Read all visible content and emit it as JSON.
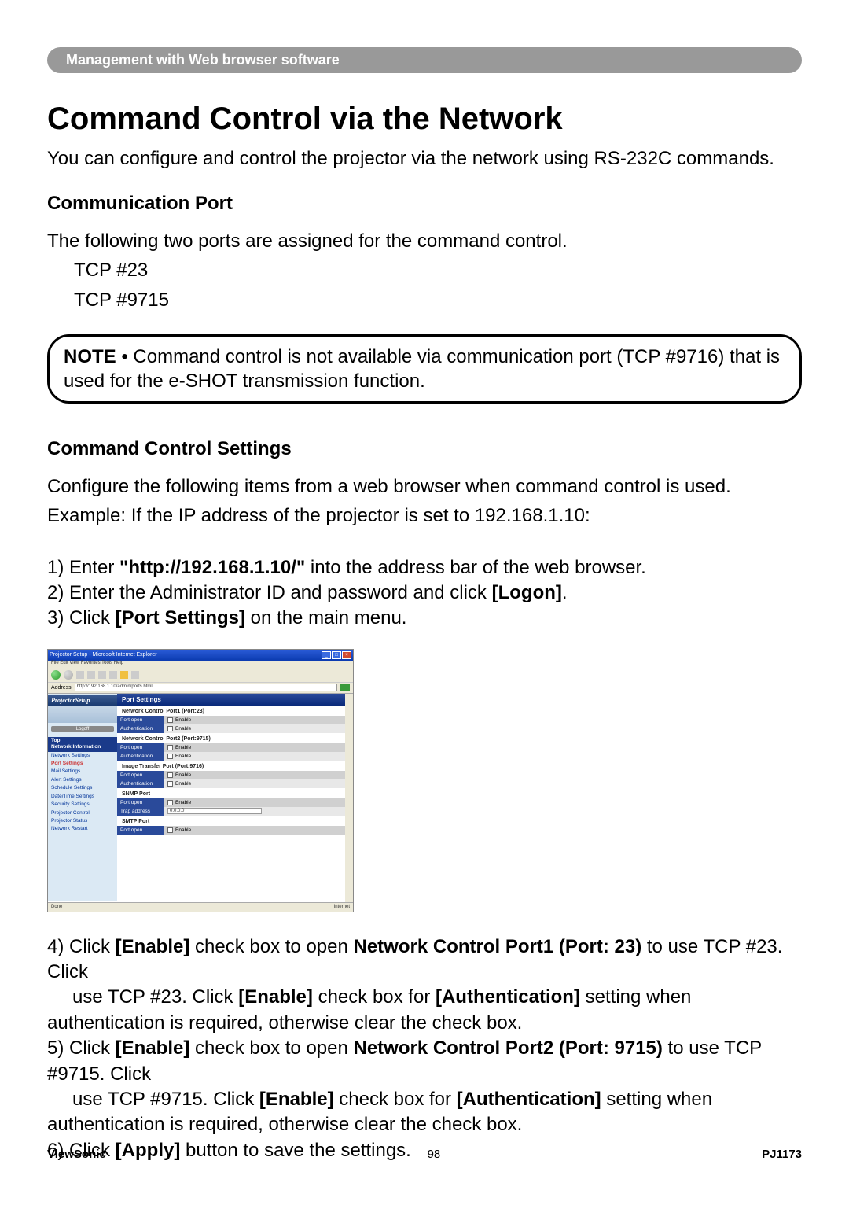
{
  "header_bar": "Management with Web browser software",
  "title": "Command Control via the Network",
  "intro": "You can configure and control the projector via the network using RS-232C commands.",
  "comm_port_heading": "Communication Port",
  "comm_port_text": "The following two ports are assigned for the command control.",
  "comm_port_1": "TCP #23",
  "comm_port_2": "TCP #9715",
  "note_label": "NOTE",
  "note_text": " • Command control is not available via communication port (TCP #9716) that is used for the e-SHOT transmission function.",
  "settings_heading": "Command Control Settings",
  "settings_text1": "Configure the following items from a web browser when command control is used.",
  "settings_text2": "Example: If the IP address of the projector is set to 192.168.1.10:",
  "step1_pre": "1) Enter ",
  "step1_bold": "\"http://192.168.1.10/\"",
  "step1_post": " into the address bar of the web browser.",
  "step2_pre": "2) Enter the Administrator ID and password and click ",
  "step2_bold": "[Logon]",
  "step2_post": ".",
  "step3_pre": "3) Click ",
  "step3_bold": "[Port Settings]",
  "step3_post": " on the main menu.",
  "step4_pre": "4) Click ",
  "step4_b1": "[Enable]",
  "step4_mid1": " check box to open ",
  "step4_b2": "Network Control Port1 (Port: 23)",
  "step4_mid2": " to use TCP #23. Click ",
  "step4_b3": "[Enable]",
  "step4_mid3": " check box for ",
  "step4_b4": "[Authentication]",
  "step4_post": " setting when authentication is required, otherwise clear the check box.",
  "step5_pre": "5) Click ",
  "step5_b1": "[Enable]",
  "step5_mid1": " check box to open ",
  "step5_b2": "Network Control Port2 (Port: 9715)",
  "step5_mid2": " to use TCP #9715. Click ",
  "step5_b3": "[Enable]",
  "step5_mid3": " check box for ",
  "step5_b4": "[Authentication]",
  "step5_post": " setting when authentication is required, otherwise clear the check box.",
  "step6_pre": "6) Click ",
  "step6_bold": "[Apply]",
  "step6_post": " button to save the settings.",
  "footer_left": "ViewSonic",
  "footer_center": "98",
  "footer_right": "PJ1173",
  "screenshot": {
    "window_title": "Projector Setup - Microsoft Internet Explorer",
    "menubar": "File  Edit  View  Favorites  Tools  Help",
    "address": "http://192.168.1.10/admin/ports.html",
    "sidebar_title": "ProjectorSetup",
    "logoff": "Logoff",
    "nav": {
      "top": "Top:",
      "network_info": "Network Information",
      "network_settings": "Network Settings",
      "port_settings": "Port Settings",
      "mail_settings": "Mail Settings",
      "alert_settings": "Alert Settings",
      "schedule_settings": "Schedule Settings",
      "date_time": "Date/Time Settings",
      "security": "Security Settings",
      "projector_control": "Projector Control",
      "projector_status": "Projector Status",
      "network_restart": "Network Restart"
    },
    "panel_title": "Port Settings",
    "sections": {
      "nc1": "Network Control Port1 (Port:23)",
      "nc2": "Network Control Port2 (Port:9715)",
      "img": "Image Transfer Port (Port:9716)",
      "snmp": "SNMP Port",
      "smtp": "SMTP Port"
    },
    "labels": {
      "port_open": "Port open",
      "authentication": "Authentication",
      "trap_address": "Trap address"
    },
    "enable": "Enable",
    "trap_ip": "0.0.0.0",
    "status_done": "Done",
    "status_zone": "Internet"
  }
}
